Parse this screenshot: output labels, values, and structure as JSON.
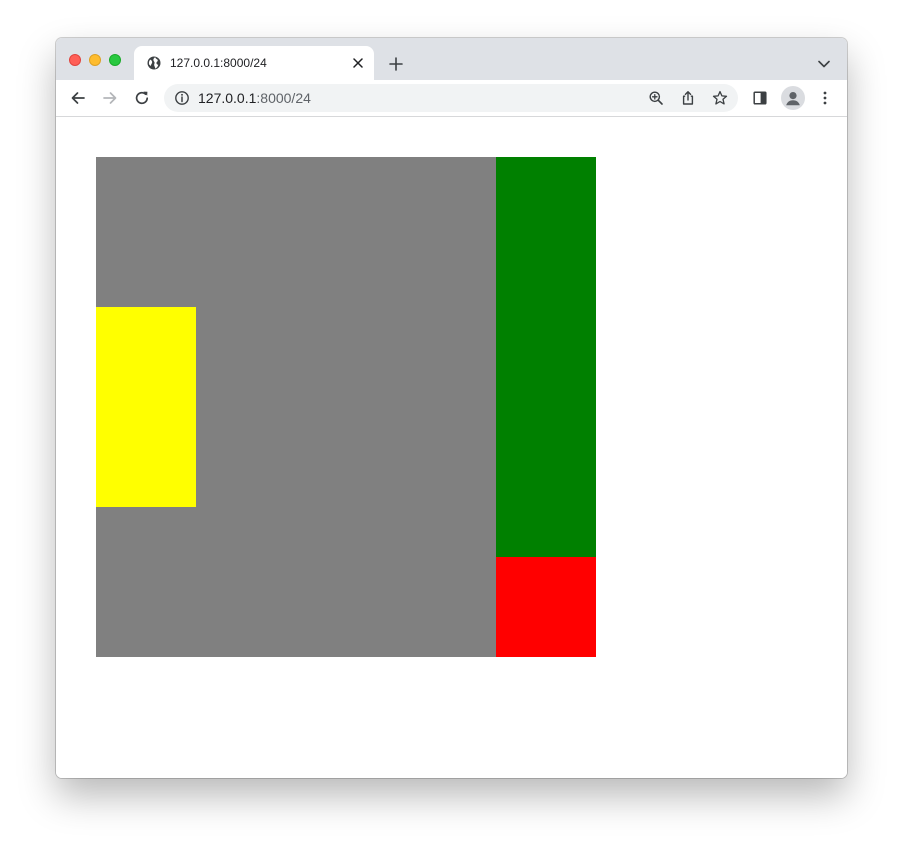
{
  "tab": {
    "title": "127.0.0.1:8000/24",
    "favicon": "globe-icon"
  },
  "address_bar": {
    "host": "127.0.0.1",
    "path": ":8000/24"
  },
  "icons": {
    "back": "arrow-left-icon",
    "forward": "arrow-right-icon",
    "reload": "reload-icon",
    "info": "info-icon",
    "zoom": "zoom-in-icon",
    "share": "share-icon",
    "bookmark": "star-icon",
    "side_panel": "side-panel-icon",
    "profile": "profile-icon",
    "menu": "kebab-menu-icon",
    "new_tab": "plus-icon",
    "tab_search": "chevron-down-icon",
    "close_tab": "close-icon"
  },
  "page": {
    "colors": {
      "gray_box": "#808080",
      "green_box": "#008000",
      "red_box": "#ff0000",
      "yellow_box": "#ffff00"
    }
  }
}
